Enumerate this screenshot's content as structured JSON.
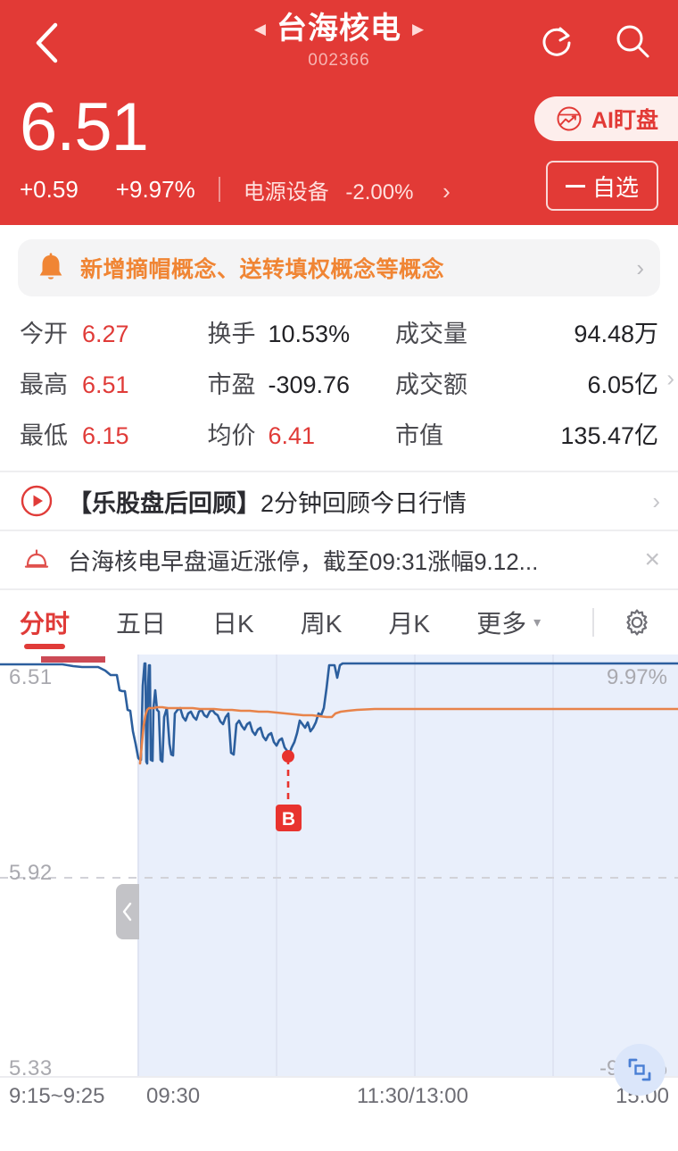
{
  "header": {
    "back_icon": "chevron-left-icon",
    "stock_name": "台海核电",
    "stock_code": "002366",
    "prev_arrow": "◀",
    "next_arrow": "▶",
    "refresh_icon": "refresh-icon",
    "search_icon": "search-icon",
    "price": "6.51",
    "change_abs": "+0.59",
    "change_pct": "+9.97%",
    "sector_name": "电源设备",
    "sector_pct": "-2.00%",
    "sector_arrow": "›",
    "ai_button_label": "AI盯盘",
    "ai_button_icon": "ai-chart-circle-icon",
    "watchlist_label": "自选",
    "watchlist_icon": "minus-icon",
    "bg_color": "#e23a36"
  },
  "banner": {
    "icon": "bell-icon",
    "text": "新增摘帽概念、送转填权概念等概念",
    "arrow": "›",
    "text_color": "#f08534",
    "bg_color": "#f4f4f5"
  },
  "stats": {
    "arrow": "›",
    "items": [
      {
        "key": "今开",
        "value": "6.27",
        "color": "red"
      },
      {
        "key": "换手",
        "value": "10.53%",
        "color": "dark"
      },
      {
        "key": "成交量",
        "value": "94.48万",
        "color": "dark"
      },
      {
        "key": "最高",
        "value": "6.51",
        "color": "red"
      },
      {
        "key": "市盈",
        "value": "-309.76",
        "color": "dark"
      },
      {
        "key": "成交额",
        "value": "6.05亿",
        "color": "dark"
      },
      {
        "key": "最低",
        "value": "6.15",
        "color": "red"
      },
      {
        "key": "均价",
        "value": "6.41",
        "color": "red"
      },
      {
        "key": "市值",
        "value": "135.47亿",
        "color": "dark"
      }
    ]
  },
  "video_row": {
    "icon": "play-circle-icon",
    "title_bold": "【乐股盘后回顾】",
    "title_rest": "2分钟回顾今日行情",
    "arrow": "›"
  },
  "alert_row": {
    "icon": "alarm-icon",
    "text": "台海核电早盘逼近涨停，截至09:31涨幅9.12...",
    "close": "×"
  },
  "tabs": {
    "items": [
      {
        "label": "分时",
        "active": true
      },
      {
        "label": "五日",
        "active": false
      },
      {
        "label": "日K",
        "active": false
      },
      {
        "label": "周K",
        "active": false
      },
      {
        "label": "月K",
        "active": false
      },
      {
        "label": "更多",
        "active": false,
        "caret": "▾"
      }
    ],
    "settings_icon": "gear-icon",
    "active_color": "#e03b38"
  },
  "chart_controls": {
    "drag_handle_icon": "chevron-left-icon",
    "expand_icon": "fullscreen-icon"
  },
  "chart_data": {
    "type": "line",
    "title": "分时",
    "xlabel": "",
    "ylabel": "",
    "grid": true,
    "legend_position": "none",
    "y_axis_left": {
      "top": "6.51",
      "mid": "5.92",
      "bottom": "5.33"
    },
    "y_axis_right": {
      "top": "9.97%",
      "bottom": "-9.97%"
    },
    "ylim": [
      5.33,
      6.51
    ],
    "x_ticks": [
      "9:15~9:25",
      "09:30",
      "11:30/13:00",
      "15:00"
    ],
    "prev_close": 5.92,
    "limit_up": 6.51,
    "limit_down": 5.33,
    "series": [
      {
        "name": "price",
        "color": "#2c5f9e",
        "values": [
          6.51,
          6.51,
          6.51,
          6.51,
          6.51,
          6.51,
          6.51,
          6.51,
          6.51,
          6.5,
          6.5,
          6.5,
          6.5,
          6.5,
          6.5,
          6.5,
          6.49,
          6.46,
          6.46,
          6.44,
          6.41,
          6.38,
          6.34,
          6.3,
          6.28,
          6.28,
          6.17,
          6.48,
          6.17,
          6.5,
          6.19,
          6.46,
          6.32,
          6.41,
          6.18,
          6.42,
          6.4,
          6.38,
          6.36,
          6.34,
          6.2,
          6.41,
          6.37,
          6.39,
          6.35,
          6.39,
          6.38,
          6.34,
          6.37,
          6.39,
          6.38,
          6.36,
          6.39,
          6.38,
          6.22,
          6.36,
          6.37,
          6.33,
          6.35,
          6.34,
          6.31,
          6.34,
          6.32,
          6.3,
          6.28,
          6.31,
          6.29,
          6.27,
          6.25,
          6.27,
          6.24,
          6.22,
          6.25,
          6.28,
          6.33,
          6.4,
          6.36,
          6.34,
          6.38,
          6.32,
          6.34,
          6.37,
          6.41,
          6.4,
          6.43,
          6.51,
          6.51,
          6.51,
          6.48,
          6.51,
          6.51,
          6.51,
          6.51,
          6.51,
          6.51,
          6.51,
          6.51,
          6.51,
          6.51,
          6.51,
          6.51,
          6.51,
          6.51,
          6.51,
          6.51,
          6.51,
          6.51,
          6.51,
          6.51,
          6.51,
          6.51,
          6.51,
          6.51,
          6.51,
          6.51,
          6.51,
          6.51,
          6.51,
          6.51,
          6.51
        ]
      },
      {
        "name": "average",
        "color": "#e8834a",
        "values": [
          null,
          null,
          null,
          null,
          null,
          null,
          null,
          null,
          null,
          null,
          null,
          null,
          null,
          null,
          null,
          null,
          null,
          null,
          null,
          null,
          null,
          null,
          null,
          null,
          null,
          null,
          6.17,
          6.33,
          6.36,
          6.4,
          6.41,
          6.41,
          6.41,
          6.42,
          6.41,
          6.41,
          6.42,
          6.42,
          6.42,
          6.42,
          6.41,
          6.42,
          6.42,
          6.42,
          6.42,
          6.42,
          6.42,
          6.42,
          6.42,
          6.42,
          6.42,
          6.42,
          6.42,
          6.41,
          6.41,
          6.41,
          6.41,
          6.41,
          6.41,
          6.41,
          6.41,
          6.41,
          6.41,
          6.41,
          6.4,
          6.4,
          6.4,
          6.4,
          6.4,
          6.4,
          6.4,
          6.4,
          6.4,
          6.4,
          6.4,
          6.41,
          6.41,
          6.41,
          6.41,
          6.41,
          6.41,
          6.41,
          6.41,
          6.41,
          6.41,
          6.41,
          6.41,
          6.41,
          6.41,
          6.41,
          6.41,
          6.41,
          6.41,
          6.41,
          6.41,
          6.41,
          6.41,
          6.41,
          6.41,
          6.41,
          6.41,
          6.41,
          6.41,
          6.41,
          6.41,
          6.41,
          6.41,
          6.41,
          6.41,
          6.41,
          6.41,
          6.41,
          6.41,
          6.41,
          6.41,
          6.41,
          6.41,
          6.41,
          6.41,
          6.41
        ]
      }
    ],
    "markers": [
      {
        "label": "B",
        "type": "buy",
        "x_index": 73,
        "value": 6.28,
        "color": "#e8332e"
      }
    ]
  }
}
